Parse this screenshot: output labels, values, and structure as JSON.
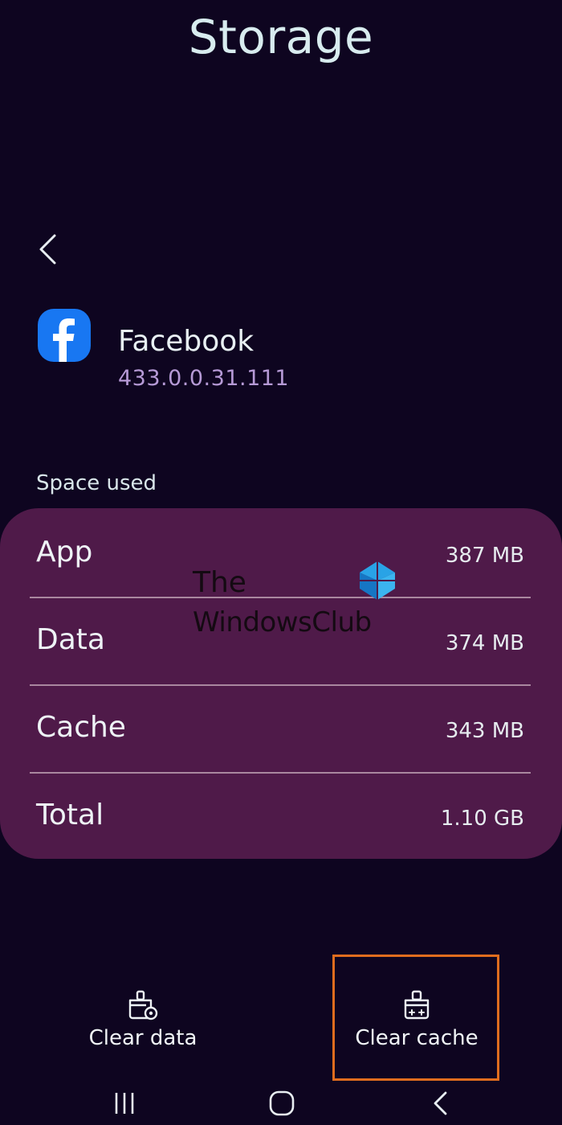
{
  "header": {
    "title": "Storage"
  },
  "app": {
    "name": "Facebook",
    "version": "433.0.0.31.111",
    "icon": "facebook-logo-icon"
  },
  "storage": {
    "section_label": "Space used",
    "rows": [
      {
        "label": "App",
        "value": "387 MB"
      },
      {
        "label": "Data",
        "value": "374 MB"
      },
      {
        "label": "Cache",
        "value": "343 MB"
      },
      {
        "label": "Total",
        "value": "1.10 GB"
      }
    ]
  },
  "watermark": {
    "line1": "The",
    "line2": "WindowsClub"
  },
  "actions": {
    "clear_data": "Clear data",
    "clear_cache": "Clear cache"
  },
  "colors": {
    "background": "#0e0520",
    "card": "#4f1a49",
    "version_text": "#b69ad6",
    "facebook_blue": "#1877f2",
    "highlight": "#e06d1e"
  }
}
